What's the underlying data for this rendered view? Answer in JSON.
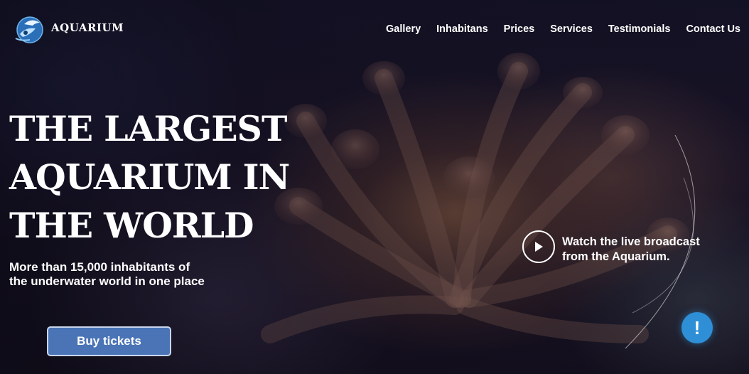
{
  "header": {
    "logo_text": "AQUARIUM",
    "nav": [
      {
        "label": "Gallery"
      },
      {
        "label": "Inhabitans"
      },
      {
        "label": "Prices"
      },
      {
        "label": "Services"
      },
      {
        "label": "Testimonials"
      },
      {
        "label": "Contact Us"
      }
    ]
  },
  "hero": {
    "headline_lines": [
      "THE LARGEST",
      "AQUARIUM IN",
      "THE WORLD"
    ],
    "subheadline_lines": [
      "More than 15,000 inhabitants of",
      "the underwater world in one place"
    ],
    "buy_button_label": "Buy tickets",
    "broadcast_lines": [
      "Watch the live broadcast",
      "from the Aquarium."
    ],
    "info_button_glyph": "!"
  },
  "icons": {
    "logo": "aquarium-globe-dolphin-icon",
    "play": "play-icon",
    "info": "exclamation-icon"
  },
  "colors": {
    "button_blue": "#4a74b6",
    "info_blue": "#2f8fd6",
    "text": "#ffffff"
  }
}
